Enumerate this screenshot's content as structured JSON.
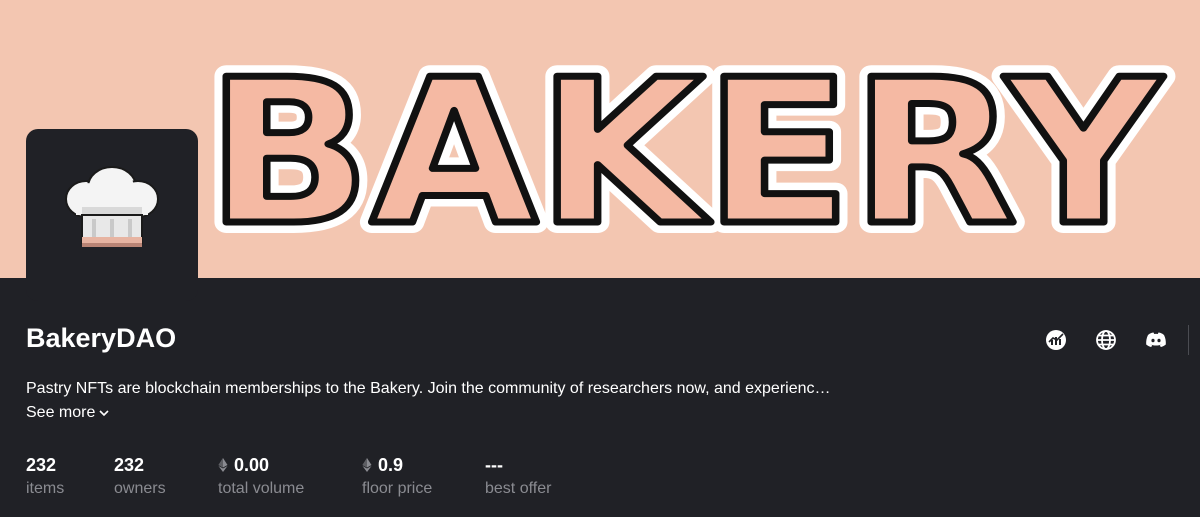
{
  "banner": {
    "text": "BAKERY",
    "background_color": "#f3c6b1",
    "letter_fill": "#f5b9a3"
  },
  "avatar": {
    "icon": "chef-hat-icon",
    "background_color": "#202126"
  },
  "collection": {
    "name": "BakeryDAO",
    "description": "Pastry NFTs are blockchain memberships to the Bakery. Join the community of researchers now, and experienc…",
    "see_more_label": "See more"
  },
  "social_links": [
    {
      "icon": "activity-chart-icon"
    },
    {
      "icon": "globe-icon"
    },
    {
      "icon": "discord-icon"
    }
  ],
  "stats": [
    {
      "value": "232",
      "label": "items",
      "eth": false
    },
    {
      "value": "232",
      "label": "owners",
      "eth": false
    },
    {
      "value": "0.00",
      "label": "total volume",
      "eth": true
    },
    {
      "value": "0.9",
      "label": "floor price",
      "eth": true
    },
    {
      "value": "---",
      "label": "best offer",
      "eth": false
    }
  ]
}
